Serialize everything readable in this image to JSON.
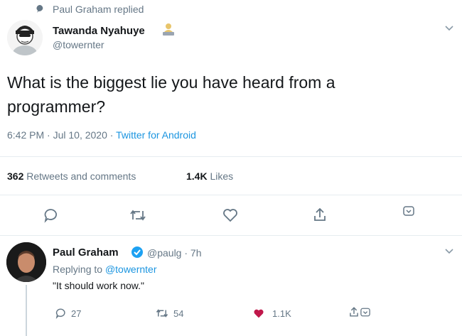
{
  "context": {
    "text": "Paul Graham replied",
    "icon": "speech-bubble-icon"
  },
  "original_tweet": {
    "display_name": "Tawanda Nyahuye",
    "name_emoji_icon": "person-laptop-emoji-icon",
    "handle": "@towernter",
    "text_line1": "What is the biggest lie you have heard from a",
    "text_line2": "programmer?",
    "timestamp": "6:42 PM · Jul 10, 2020 · ",
    "source": "Twitter for Android",
    "stats": {
      "retweets_count": "362",
      "retweets_label": "Retweets and comments",
      "likes_count": "1.4K",
      "likes_label": "Likes"
    },
    "actions": [
      "reply-icon",
      "retweet-icon",
      "like-icon",
      "share-icon",
      "more-icon"
    ]
  },
  "reply_tweet": {
    "display_name": "Paul Graham",
    "verified": true,
    "handle": "@paulg",
    "time": " · 7h",
    "replying_label": "Replying to ",
    "replying_handle": "@towernter",
    "text": "\"It should work now.\"",
    "stats": {
      "replies": "27",
      "retweets": "54",
      "likes": "1.1K"
    },
    "like_color": "#c0174a"
  },
  "colors": {
    "accent": "#1b95e0",
    "secondary_text": "#657786",
    "primary_text": "#14171a",
    "liked": "#c0174a",
    "verified": "#1da1f2"
  }
}
